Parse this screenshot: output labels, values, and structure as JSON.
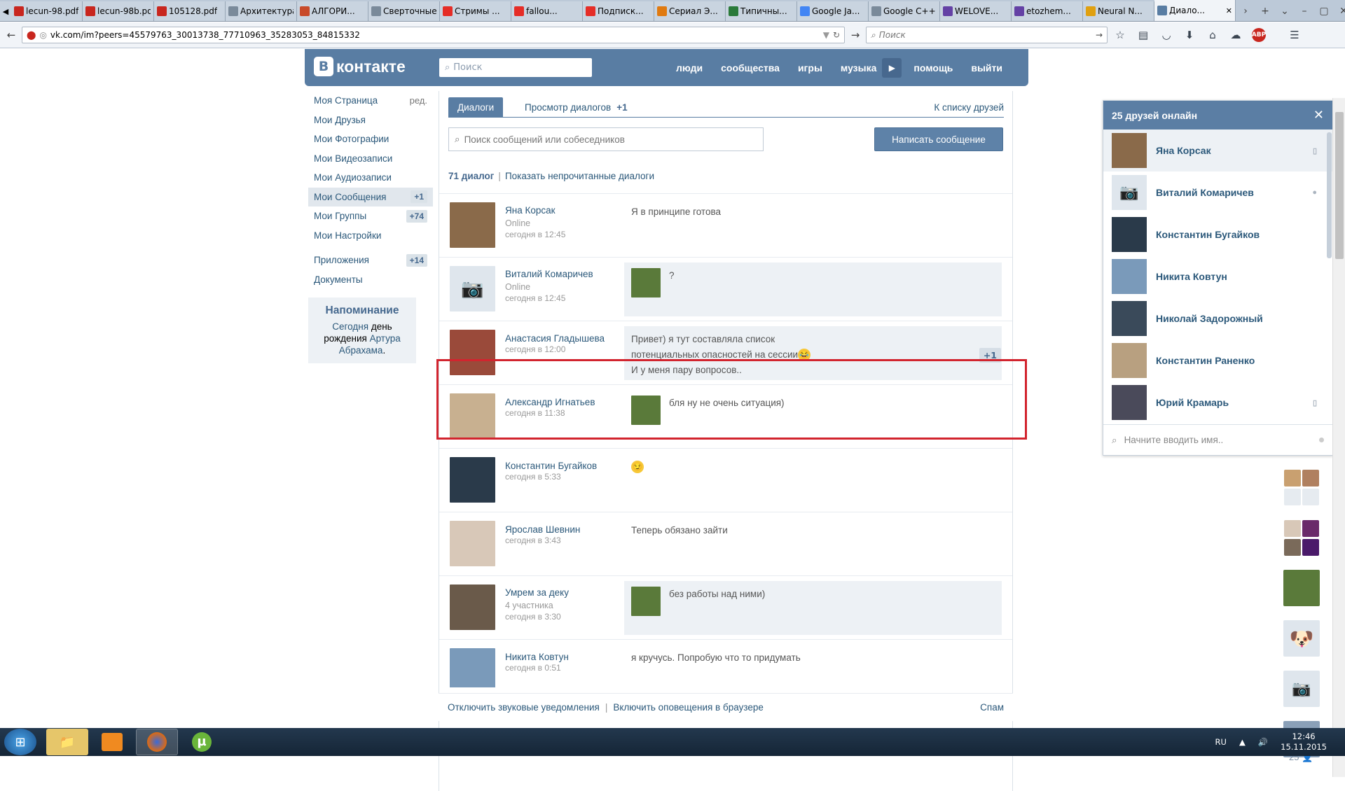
{
  "browser": {
    "tabs": [
      {
        "label": "lecun-98.pdf",
        "icon": "pdf-icon",
        "color": "#c8261e"
      },
      {
        "label": "lecun-98b.pdf",
        "icon": "pdf-icon",
        "color": "#c8261e"
      },
      {
        "label": "105128.pdf",
        "icon": "pdf-icon",
        "color": "#c8261e"
      },
      {
        "label": "Архитектура ...",
        "icon": "page-icon",
        "color": "#7a8a9a"
      },
      {
        "label": "АЛГОРИ...",
        "icon": "habr-icon",
        "color": "#c84a2a"
      },
      {
        "label": "Сверточные ...",
        "icon": "page-icon",
        "color": "#7a8a9a"
      },
      {
        "label": "Стримы ...",
        "icon": "youtube-icon",
        "color": "#e52d27"
      },
      {
        "label": "fallou...",
        "icon": "youtube-icon",
        "color": "#e52d27"
      },
      {
        "label": "Подписк...",
        "icon": "youtube-icon",
        "color": "#e52d27"
      },
      {
        "label": "Сериал Э...",
        "icon": "pencil-icon",
        "color": "#e07a10"
      },
      {
        "label": "Типичны...",
        "icon": "bug-icon",
        "color": "#2a7a3a"
      },
      {
        "label": "Google Ja...",
        "icon": "google-icon",
        "color": "#4285f4"
      },
      {
        "label": "Google C++ ...",
        "icon": "page-icon",
        "color": "#7a8a9a"
      },
      {
        "label": "WELOVE...",
        "icon": "twitch-icon",
        "color": "#6441a5"
      },
      {
        "label": "etozhem...",
        "icon": "twitch-icon",
        "color": "#6441a5"
      },
      {
        "label": "Neural N...",
        "icon": "bulb-icon",
        "color": "#e0a010"
      },
      {
        "label": "Диало...",
        "icon": "vk-icon",
        "color": "#597da3",
        "active": true
      }
    ],
    "url": "vk.com/im?peers=45579763_30013738_77710963_35283053_84815332",
    "search_placeholder": "Поиск",
    "abp_label": "ABP"
  },
  "vk": {
    "logo_letter": "В",
    "logo_text": "контакте",
    "search_placeholder": "Поиск",
    "nav": [
      "люди",
      "сообщества",
      "игры",
      "музыка",
      "помощь",
      "выйти"
    ],
    "play_icon": "▶"
  },
  "menu": [
    {
      "label": "Моя Страница",
      "extra": "ред."
    },
    {
      "label": "Мои Друзья"
    },
    {
      "label": "Мои Фотографии"
    },
    {
      "label": "Мои Видеозаписи"
    },
    {
      "label": "Мои Аудиозаписи"
    },
    {
      "label": "Мои Сообщения",
      "count": "+1",
      "selected": true
    },
    {
      "label": "Мои Группы",
      "count": "+74"
    },
    {
      "label": "Мои Настройки"
    },
    {
      "label": "Приложения",
      "count": "+14"
    },
    {
      "label": "Документы"
    }
  ],
  "reminder": {
    "title": "Напоминание",
    "today": "Сегодня",
    "text1": "день рождения",
    "person1": "Артура",
    "person2": "Абрахама",
    "dot": "."
  },
  "messages": {
    "tab_dialogs": "Диалоги",
    "tab_view": "Просмотр диалогов",
    "tab_view_count": "+1",
    "friends_link": "К списку друзей",
    "search_placeholder": "Поиск сообщений или собеседников",
    "write_button": "Написать сообщение",
    "count_label": "71 диалог",
    "unread_link": "Показать непрочитанные диалоги",
    "sep": "|"
  },
  "dialogs": [
    {
      "name": "Яна Корсак",
      "status": "Online",
      "time": "сегодня в 12:45",
      "text": "Я в принципе готова",
      "avatar": "#8a6a4a"
    },
    {
      "name": "Виталий Комаричев",
      "status": "Online",
      "time": "сегодня в 12:45",
      "text": "?",
      "avatar": "#dfe6ed",
      "mine": true,
      "unread": true
    },
    {
      "name": "Анастасия Гладышева",
      "status": "",
      "time": "сегодня в 12:00",
      "text": "Привет) я тут составляла список потенциальных опасностей на сессии",
      "text2": "И у меня пару вопросов..",
      "emoji": "😂",
      "avatar": "#9a4a3a",
      "unread": true,
      "badge": "+1"
    },
    {
      "name": "Александр Игнатьев",
      "status": "",
      "time": "сегодня в 11:38",
      "text": "бля ну не очень ситуация)",
      "avatar": "#c8b090",
      "mine": true
    },
    {
      "name": "Константин Бугайков",
      "status": "",
      "time": "сегодня в 5:33",
      "text": "",
      "emoji": "😏",
      "avatar": "#2a3a4a"
    },
    {
      "name": "Ярослав Шевнин",
      "status": "",
      "time": "сегодня в 3:43",
      "text": "Теперь обязано зайти",
      "avatar": "#d8c8b8"
    },
    {
      "name": "Умрем за деку",
      "status": "4 участника",
      "time": "сегодня в 3:30",
      "text": "без работы над ними)",
      "avatar": "#6a5a4a",
      "mine": true,
      "unread": true
    },
    {
      "name": "Никита Ковтун",
      "status": "",
      "time": "сегодня в 0:51",
      "text": "я кручусь. Попробую что то придумать",
      "avatar": "#7a9aba"
    }
  ],
  "footer": {
    "sound": "Отключить звуковые уведомления",
    "browser": "Включить оповещения в браузере",
    "spam": "Спам",
    "sep": "|"
  },
  "online": {
    "title": "25 друзей онлайн",
    "close": "✕",
    "friends": [
      {
        "name": "Яна Корсак",
        "avatar": "#8a6a4a",
        "mobile": true
      },
      {
        "name": "Виталий Комаричев",
        "avatar": "#dfe6ed",
        "dot": true
      },
      {
        "name": "Константин Бугайков",
        "avatar": "#2a3a4a"
      },
      {
        "name": "Никита Ковтун",
        "avatar": "#7a9aba"
      },
      {
        "name": "Николай Задорожный",
        "avatar": "#3a4a5a"
      },
      {
        "name": "Константин Раненко",
        "avatar": "#b8a080"
      },
      {
        "name": "Юрий Крамарь",
        "avatar": "#4a4a5a",
        "mobile": true
      }
    ],
    "search_placeholder": "Начните вводить имя..",
    "count": "25"
  },
  "taskbar": {
    "lang": "RU",
    "time": "12:46",
    "date": "15.11.2015"
  }
}
